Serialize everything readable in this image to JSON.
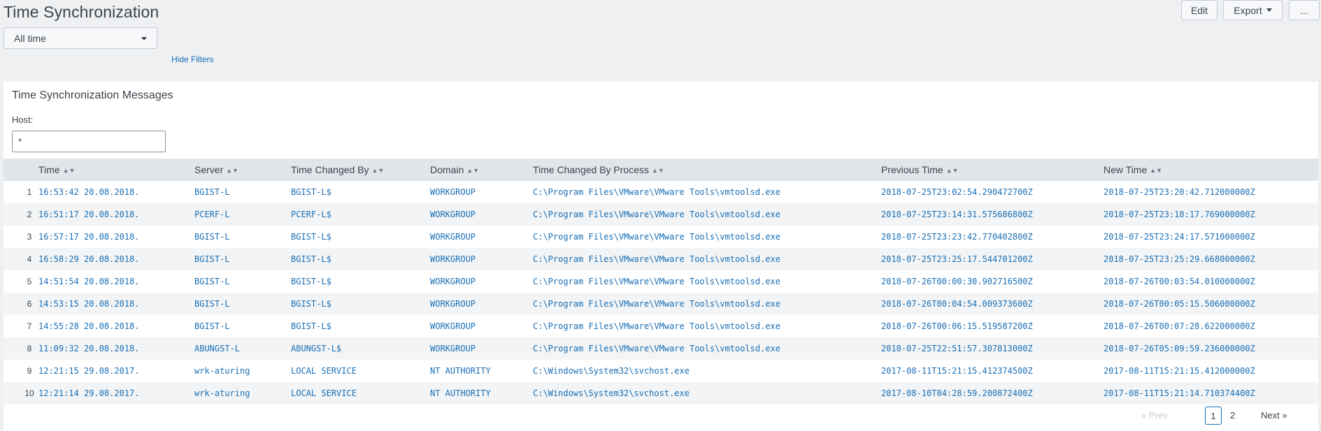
{
  "page": {
    "title": "Time Synchronization"
  },
  "toolbar": {
    "edit_label": "Edit",
    "export_label": "Export",
    "more_label": "..."
  },
  "filters": {
    "time_range": "All time",
    "hide_filters_label": "Hide Filters"
  },
  "panel": {
    "title": "Time Synchronization Messages",
    "host_label": "Host:",
    "host_value": "*"
  },
  "table": {
    "columns": [
      "Time",
      "Server",
      "Time Changed By",
      "Domain",
      "Time Changed By Process",
      "Previous Time",
      "New Time"
    ],
    "rows": [
      {
        "n": "1",
        "time": "16:53:42 20.08.2018.",
        "server": "BGIST-L",
        "changed_by": "BGIST-L$",
        "domain": "WORKGROUP",
        "process": "C:\\Program Files\\VMware\\VMware Tools\\vmtoolsd.exe",
        "previous": "2018-07-25T23:02:54.290472700Z",
        "new": "2018-07-25T23:20:42.712000000Z"
      },
      {
        "n": "2",
        "time": "16:51:17 20.08.2018.",
        "server": "PCERF-L",
        "changed_by": "PCERF-L$",
        "domain": "WORKGROUP",
        "process": "C:\\Program Files\\VMware\\VMware Tools\\vmtoolsd.exe",
        "previous": "2018-07-25T23:14:31.575686800Z",
        "new": "2018-07-25T23:18:17.769000000Z"
      },
      {
        "n": "3",
        "time": "16:57:17 20.08.2018.",
        "server": "BGIST-L",
        "changed_by": "BGIST-L$",
        "domain": "WORKGROUP",
        "process": "C:\\Program Files\\VMware\\VMware Tools\\vmtoolsd.exe",
        "previous": "2018-07-25T23:23:42.770402800Z",
        "new": "2018-07-25T23:24:17.571000000Z"
      },
      {
        "n": "4",
        "time": "16:58:29 20.08.2018.",
        "server": "BGIST-L",
        "changed_by": "BGIST-L$",
        "domain": "WORKGROUP",
        "process": "C:\\Program Files\\VMware\\VMware Tools\\vmtoolsd.exe",
        "previous": "2018-07-25T23:25:17.544701200Z",
        "new": "2018-07-25T23:25:29.668000000Z"
      },
      {
        "n": "5",
        "time": "14:51:54 20.08.2018.",
        "server": "BGIST-L",
        "changed_by": "BGIST-L$",
        "domain": "WORKGROUP",
        "process": "C:\\Program Files\\VMware\\VMware Tools\\vmtoolsd.exe",
        "previous": "2018-07-26T00:00:30.902716500Z",
        "new": "2018-07-26T00:03:54.010000000Z"
      },
      {
        "n": "6",
        "time": "14:53:15 20.08.2018.",
        "server": "BGIST-L",
        "changed_by": "BGIST-L$",
        "domain": "WORKGROUP",
        "process": "C:\\Program Files\\VMware\\VMware Tools\\vmtoolsd.exe",
        "previous": "2018-07-26T00:04:54.009373600Z",
        "new": "2018-07-26T00:05:15.506000000Z"
      },
      {
        "n": "7",
        "time": "14:55:28 20.08.2018.",
        "server": "BGIST-L",
        "changed_by": "BGIST-L$",
        "domain": "WORKGROUP",
        "process": "C:\\Program Files\\VMware\\VMware Tools\\vmtoolsd.exe",
        "previous": "2018-07-26T00:06:15.519587200Z",
        "new": "2018-07-26T00:07:28.622000000Z"
      },
      {
        "n": "8",
        "time": "11:09:32 20.08.2018.",
        "server": "ABUNGST-L",
        "changed_by": "ABUNGST-L$",
        "domain": "WORKGROUP",
        "process": "C:\\Program Files\\VMware\\VMware Tools\\vmtoolsd.exe",
        "previous": "2018-07-25T22:51:57.307813000Z",
        "new": "2018-07-26T05:09:59.236000000Z"
      },
      {
        "n": "9",
        "time": "12:21:15 29.08.2017.",
        "server": "wrk-aturing",
        "changed_by": "LOCAL SERVICE",
        "domain": "NT AUTHORITY",
        "process": "C:\\Windows\\System32\\svchost.exe",
        "previous": "2017-08-11T15:21:15.412374500Z",
        "new": "2017-08-11T15:21:15.412000000Z"
      },
      {
        "n": "10",
        "time": "12:21:14 29.08.2017.",
        "server": "wrk-aturing",
        "changed_by": "LOCAL SERVICE",
        "domain": "NT AUTHORITY",
        "process": "C:\\Windows\\System32\\svchost.exe",
        "previous": "2017-08-10T04:28:59.200872400Z",
        "new": "2017-08-11T15:21:14.710374400Z"
      }
    ]
  },
  "pagination": {
    "prev_label": "« Prev",
    "pages": [
      "1",
      "2"
    ],
    "current_page": "1",
    "next_label": "Next »"
  },
  "colors": {
    "link": "#1a6fb5",
    "header_bg": "#e1e6eb",
    "page_bg": "#eef0f2"
  }
}
